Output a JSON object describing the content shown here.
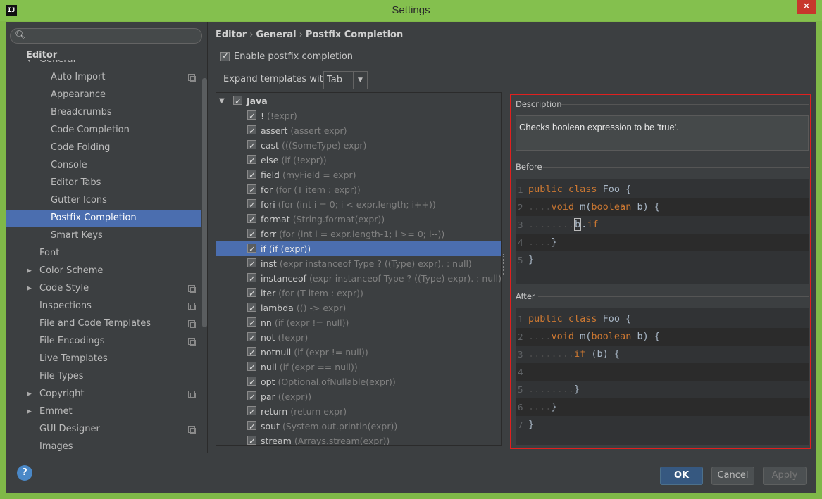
{
  "window": {
    "title": "Settings",
    "app_icon": "IJ",
    "close_label": "✕"
  },
  "search": {
    "placeholder": "",
    "value": ""
  },
  "sidebar": {
    "header": "Editor",
    "items": [
      {
        "label": "General",
        "indent": 1,
        "arrow": "▼",
        "badge": false,
        "selected": false
      },
      {
        "label": "Auto Import",
        "indent": 2,
        "arrow": "",
        "badge": true,
        "selected": false
      },
      {
        "label": "Appearance",
        "indent": 2,
        "arrow": "",
        "badge": false,
        "selected": false
      },
      {
        "label": "Breadcrumbs",
        "indent": 2,
        "arrow": "",
        "badge": false,
        "selected": false
      },
      {
        "label": "Code Completion",
        "indent": 2,
        "arrow": "",
        "badge": false,
        "selected": false
      },
      {
        "label": "Code Folding",
        "indent": 2,
        "arrow": "",
        "badge": false,
        "selected": false
      },
      {
        "label": "Console",
        "indent": 2,
        "arrow": "",
        "badge": false,
        "selected": false
      },
      {
        "label": "Editor Tabs",
        "indent": 2,
        "arrow": "",
        "badge": false,
        "selected": false
      },
      {
        "label": "Gutter Icons",
        "indent": 2,
        "arrow": "",
        "badge": false,
        "selected": false
      },
      {
        "label": "Postfix Completion",
        "indent": 2,
        "arrow": "",
        "badge": false,
        "selected": true
      },
      {
        "label": "Smart Keys",
        "indent": 2,
        "arrow": "",
        "badge": false,
        "selected": false
      },
      {
        "label": "Font",
        "indent": 1,
        "arrow": "",
        "badge": false,
        "selected": false
      },
      {
        "label": "Color Scheme",
        "indent": 1,
        "arrow": "▶",
        "badge": false,
        "selected": false
      },
      {
        "label": "Code Style",
        "indent": 1,
        "arrow": "▶",
        "badge": true,
        "selected": false
      },
      {
        "label": "Inspections",
        "indent": 1,
        "arrow": "",
        "badge": true,
        "selected": false
      },
      {
        "label": "File and Code Templates",
        "indent": 1,
        "arrow": "",
        "badge": true,
        "selected": false
      },
      {
        "label": "File Encodings",
        "indent": 1,
        "arrow": "",
        "badge": true,
        "selected": false
      },
      {
        "label": "Live Templates",
        "indent": 1,
        "arrow": "",
        "badge": false,
        "selected": false
      },
      {
        "label": "File Types",
        "indent": 1,
        "arrow": "",
        "badge": false,
        "selected": false
      },
      {
        "label": "Copyright",
        "indent": 1,
        "arrow": "▶",
        "badge": true,
        "selected": false
      },
      {
        "label": "Emmet",
        "indent": 1,
        "arrow": "▶",
        "badge": false,
        "selected": false
      },
      {
        "label": "GUI Designer",
        "indent": 1,
        "arrow": "",
        "badge": true,
        "selected": false
      },
      {
        "label": "Images",
        "indent": 1,
        "arrow": "",
        "badge": false,
        "selected": false
      }
    ]
  },
  "breadcrumb": [
    "Editor",
    "General",
    "Postfix Completion"
  ],
  "breadcrumb_sep": "›",
  "enable_postfix": {
    "label": "Enable postfix completion",
    "checked": true
  },
  "expand": {
    "label": "Expand templates with",
    "value": "Tab",
    "arrow": "▼"
  },
  "templates": {
    "root": {
      "label": "Java",
      "arrow": "▼"
    },
    "items": [
      {
        "name": "!",
        "example": "(!expr)",
        "selected": false
      },
      {
        "name": "assert",
        "example": "(assert expr)",
        "selected": false
      },
      {
        "name": "cast",
        "example": "(((SomeType) expr)",
        "selected": false
      },
      {
        "name": "else",
        "example": "(if (!expr))",
        "selected": false
      },
      {
        "name": "field",
        "example": "(myField = expr)",
        "selected": false
      },
      {
        "name": "for",
        "example": "(for (T item : expr))",
        "selected": false
      },
      {
        "name": "fori",
        "example": "(for (int i = 0; i < expr.length; i++))",
        "selected": false
      },
      {
        "name": "format",
        "example": "(String.format(expr))",
        "selected": false
      },
      {
        "name": "forr",
        "example": "(for (int i = expr.length-1; i >= 0; i--))",
        "selected": false
      },
      {
        "name": "if",
        "example": "(if (expr))",
        "selected": true
      },
      {
        "name": "inst",
        "example": "(expr instanceof Type ? ((Type) expr). : null)",
        "selected": false
      },
      {
        "name": "instanceof",
        "example": "(expr instanceof Type ? ((Type) expr). : null)",
        "selected": false
      },
      {
        "name": "iter",
        "example": "(for (T item : expr))",
        "selected": false
      },
      {
        "name": "lambda",
        "example": "(() -> expr)",
        "selected": false
      },
      {
        "name": "nn",
        "example": "(if (expr != null))",
        "selected": false
      },
      {
        "name": "not",
        "example": "(!expr)",
        "selected": false
      },
      {
        "name": "notnull",
        "example": "(if (expr != null))",
        "selected": false
      },
      {
        "name": "null",
        "example": "(if (expr == null))",
        "selected": false
      },
      {
        "name": "opt",
        "example": "(Optional.ofNullable(expr))",
        "selected": false
      },
      {
        "name": "par",
        "example": "((expr))",
        "selected": false
      },
      {
        "name": "return",
        "example": "(return expr)",
        "selected": false
      },
      {
        "name": "sout",
        "example": "(System.out.println(expr))",
        "selected": false
      },
      {
        "name": "stream",
        "example": "(Arrays.stream(expr))",
        "selected": false
      }
    ]
  },
  "description": {
    "label": "Description",
    "text": "Checks boolean expression to be 'true'."
  },
  "before": {
    "label": "Before",
    "lines": [
      {
        "n": "1",
        "dots": "",
        "parts": [
          [
            "kw",
            "public class "
          ],
          [
            "t",
            "Foo {"
          ]
        ]
      },
      {
        "n": "2",
        "dots": "....",
        "parts": [
          [
            "kw",
            "void "
          ],
          [
            "t",
            "m("
          ],
          [
            "kw",
            "boolean "
          ],
          [
            "t",
            "b) {"
          ]
        ]
      },
      {
        "n": "3",
        "dots": "........",
        "parts": [
          [
            "caret",
            "b"
          ],
          [
            "t",
            "."
          ],
          [
            "kw",
            "if"
          ]
        ]
      },
      {
        "n": "4",
        "dots": "....",
        "parts": [
          [
            "t",
            "}"
          ]
        ]
      },
      {
        "n": "5",
        "dots": "",
        "parts": [
          [
            "t",
            "}"
          ]
        ]
      }
    ]
  },
  "after": {
    "label": "After",
    "lines": [
      {
        "n": "1",
        "dots": "",
        "parts": [
          [
            "kw",
            "public class "
          ],
          [
            "t",
            "Foo {"
          ]
        ]
      },
      {
        "n": "2",
        "dots": "....",
        "parts": [
          [
            "kw",
            "void "
          ],
          [
            "t",
            "m("
          ],
          [
            "kw",
            "boolean "
          ],
          [
            "t",
            "b) {"
          ]
        ]
      },
      {
        "n": "3",
        "dots": "........",
        "parts": [
          [
            "kw",
            "if "
          ],
          [
            "t",
            "(b) {"
          ]
        ]
      },
      {
        "n": "4",
        "dots": "",
        "parts": []
      },
      {
        "n": "5",
        "dots": "........",
        "parts": [
          [
            "t",
            "}"
          ]
        ]
      },
      {
        "n": "6",
        "dots": "....",
        "parts": [
          [
            "t",
            "}"
          ]
        ]
      },
      {
        "n": "7",
        "dots": "",
        "parts": [
          [
            "t",
            "}"
          ]
        ]
      }
    ]
  },
  "buttons": {
    "help": "?",
    "ok": "OK",
    "cancel": "Cancel",
    "apply": "Apply"
  },
  "colors": {
    "selection": "#4b6eaf",
    "keyword": "#cc7832",
    "highlight_border": "#e0201f"
  }
}
